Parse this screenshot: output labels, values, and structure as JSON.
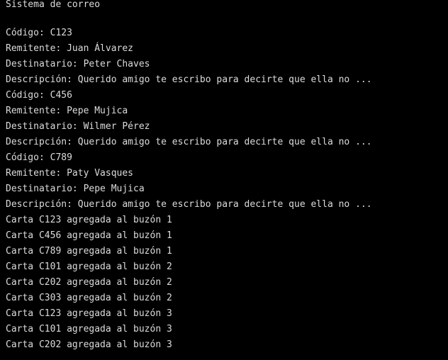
{
  "console": {
    "title": "Sistema de correo",
    "letters": [
      {
        "codigo": "Código: C123",
        "remitente": "Remitente: Juan Álvarez",
        "destinatario": "Destinatario: Peter Chaves",
        "descripcion": "Descripción: Querido amigo te escribo para decirte que ella no ..."
      },
      {
        "codigo": "Código: C456",
        "remitente": "Remitente: Pepe Mujica",
        "destinatario": "Destinatario: Wilmer Pérez",
        "descripcion": "Descripción: Querido amigo te escribo para decirte que ella no ..."
      },
      {
        "codigo": "Código: C789",
        "remitente": "Remitente: Paty Vasques",
        "destinatario": "Destinatario: Pepe Mujica",
        "descripcion": "Descripción: Querido amigo te escribo para decirte que ella no ..."
      }
    ],
    "log": [
      "Carta C123 agregada al buzón 1",
      "Carta C456 agregada al buzón 1",
      "Carta C789 agregada al buzón 1",
      "Carta C101 agregada al buzón 2",
      "Carta C202 agregada al buzón 2",
      "Carta C303 agregada al buzón 2",
      "Carta C123 agregada al buzón 3",
      "Carta C101 agregada al buzón 3",
      "Carta C202 agregada al buzón 3"
    ]
  }
}
